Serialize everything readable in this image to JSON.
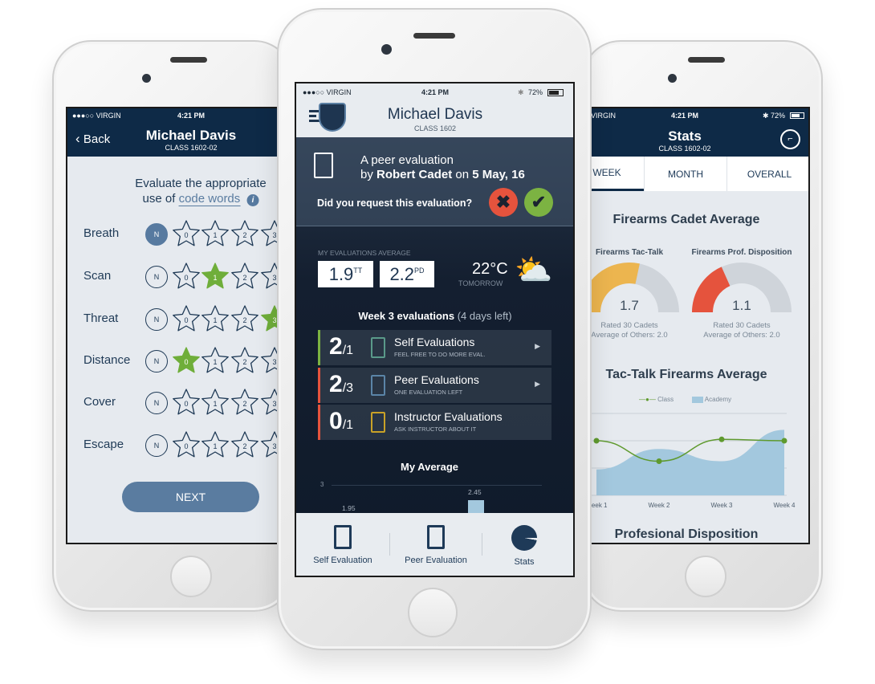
{
  "status_bar": {
    "carrier": "●●●○○ VIRGIN",
    "carrier_short": "VIRGIN",
    "time": "4:21 PM",
    "battery": "72%"
  },
  "left_screen": {
    "back_label": "Back",
    "title": "Michael Davis",
    "subtitle": "CLASS 1602-02",
    "prompt_line1": "Evaluate the appropriate",
    "prompt_prefix": "use of ",
    "prompt_link": "code words",
    "rating_options": [
      "N",
      "0",
      "1",
      "2",
      "3"
    ],
    "criteria": [
      {
        "label": "Breath",
        "selected": "N"
      },
      {
        "label": "Scan",
        "selected": "1"
      },
      {
        "label": "Threat",
        "selected": "3"
      },
      {
        "label": "Distance",
        "selected": "0"
      },
      {
        "label": "Cover",
        "selected": null
      },
      {
        "label": "Escape",
        "selected": null
      }
    ],
    "next_label": "NEXT"
  },
  "center_screen": {
    "title": "Michael Davis",
    "subtitle": "CLASS 1602",
    "notification": {
      "line1": "A peer evaluation",
      "by": "by ",
      "author": "Robert Cadet",
      "on": " on ",
      "date": "5 May, 16",
      "question": "Did you request this evaluation?"
    },
    "averages_label": "MY EVALUATIONS AVERAGE",
    "tt_value": "1.9",
    "tt_label": "TT",
    "pd_value": "2.2",
    "pd_label": "PD",
    "weather": {
      "temp": "22°C",
      "when": "TOMORROW",
      "icon": "partly-cloudy-icon"
    },
    "week_title": "Week 3 evaluations",
    "week_remaining": "(4 days left)",
    "evaluations": [
      {
        "done": "2",
        "required": "/1",
        "title": "Self Evaluations",
        "note": "FEEL FREE TO DO MORE EVAL.",
        "color": "#7cb342",
        "icon_color": "#5a9a8a",
        "has_arrow": true
      },
      {
        "done": "2",
        "required": "/3",
        "title": "Peer Evaluations",
        "note": "ONE EVALUATION LEFT",
        "color": "#e5533d",
        "icon_color": "#5b85a8",
        "has_arrow": true
      },
      {
        "done": "0",
        "required": "/1",
        "title": "Instructor Evaluations",
        "note": "ASK INSTRUCTOR  ABOUT IT",
        "color": "#e5533d",
        "icon_color": "#c9a227",
        "has_arrow": false
      }
    ],
    "my_average": {
      "title": "My Average",
      "y_tick": "3",
      "labels": [
        "1.95",
        "2.45"
      ]
    },
    "tabs": [
      {
        "label": "Self Evaluation",
        "icon": "clipboard-person-icon"
      },
      {
        "label": "Peer Evaluation",
        "icon": "clipboard-group-icon"
      },
      {
        "label": "Stats",
        "icon": "pie-chart-icon"
      }
    ],
    "colors": {
      "reject": "#e5533d",
      "accept": "#7cb342"
    }
  },
  "right_screen": {
    "title": "Stats",
    "subtitle": "CLASS 1602-02",
    "tabs": [
      "WEEK",
      "MONTH",
      "OVERALL"
    ],
    "active_tab": "WEEK",
    "section_title": "Firearms Cadet Average",
    "gauges": [
      {
        "title": "Firearms Tac-Talk",
        "value": "1.7",
        "max": 3,
        "rated": "Rated 30 Cadets",
        "others": "Average of Others: 2.0",
        "color": "#ecb54f"
      },
      {
        "title": "Firearms Prof. Disposition",
        "value": "1.1",
        "max": 3,
        "rated": "Rated 30 Cadets",
        "others": "Average of Others: 2.0",
        "color": "#e5533d"
      }
    ],
    "next_section": "Profesional Disposition"
  },
  "chart_data": {
    "type": "line",
    "title": "Tac-Talk Firearms Average",
    "categories": [
      "Week 1",
      "Week 2",
      "Week 3",
      "Week 4"
    ],
    "ylim": [
      0,
      3
    ],
    "grid": true,
    "legend": "top",
    "series": [
      {
        "name": "Class",
        "type": "line",
        "values": [
          2.0,
          1.25,
          2.05,
          2.0
        ],
        "color": "#5f9a2e"
      },
      {
        "name": "Academy",
        "type": "area",
        "values": [
          0.95,
          1.7,
          1.25,
          2.4
        ],
        "color": "#a3c8de"
      }
    ]
  }
}
